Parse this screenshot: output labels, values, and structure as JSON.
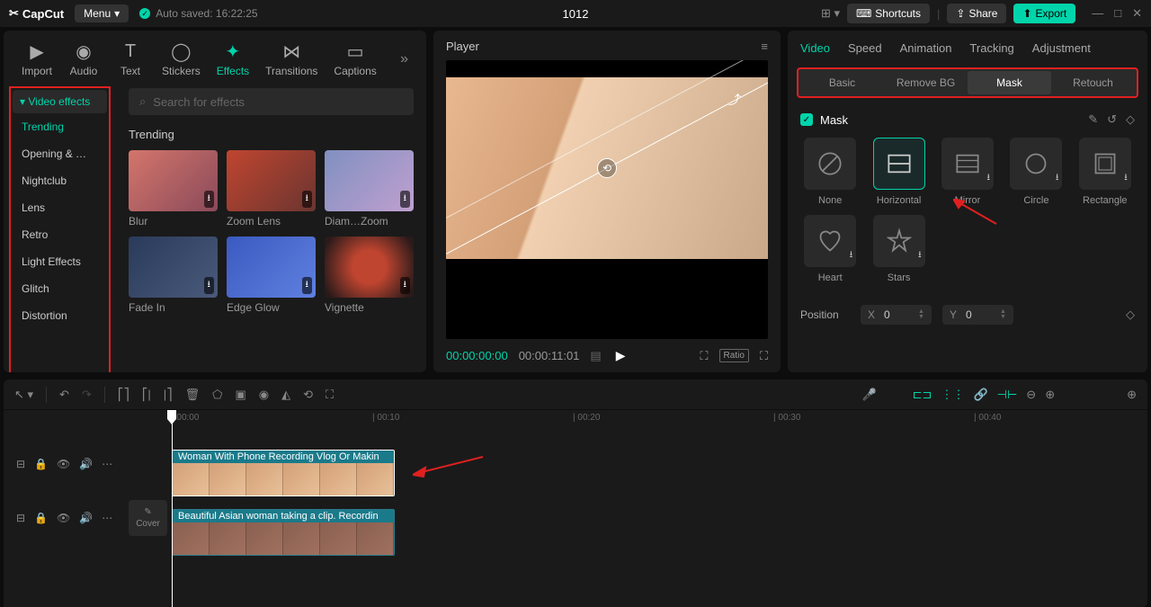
{
  "topbar": {
    "logo": "CapCut",
    "menu": "Menu",
    "autosave": "Auto saved: 16:22:25",
    "project": "1012",
    "shortcuts": "Shortcuts",
    "share": "Share",
    "export": "Export"
  },
  "tabs": {
    "items": [
      "Import",
      "Audio",
      "Text",
      "Stickers",
      "Effects",
      "Transitions",
      "Captions"
    ],
    "active": "Effects"
  },
  "sidebar": {
    "title": "Video effects",
    "items": [
      "Trending",
      "Opening & …",
      "Nightclub",
      "Lens",
      "Retro",
      "Light Effects",
      "Glitch",
      "Distortion"
    ],
    "active": "Trending"
  },
  "search": {
    "placeholder": "Search for effects"
  },
  "effects": {
    "section": "Trending",
    "items": [
      {
        "label": "Blur",
        "cls": "blur"
      },
      {
        "label": "Zoom Lens",
        "cls": "zoom"
      },
      {
        "label": "Diam…Zoom",
        "cls": "diam"
      },
      {
        "label": "Fade In",
        "cls": "fade"
      },
      {
        "label": "Edge Glow",
        "cls": "edge"
      },
      {
        "label": "Vignette",
        "cls": "vign"
      }
    ]
  },
  "player": {
    "title": "Player",
    "current": "00:00:00:00",
    "total": "00:00:11:01",
    "ratio": "Ratio"
  },
  "right": {
    "tabs": [
      "Video",
      "Speed",
      "Animation",
      "Tracking",
      "Adjustment"
    ],
    "active": "Video",
    "subtabs": [
      "Basic",
      "Remove BG",
      "Mask",
      "Retouch"
    ],
    "subactive": "Mask",
    "mask_title": "Mask",
    "masks": [
      "None",
      "Horizontal",
      "Mirror",
      "Circle",
      "Rectangle",
      "Heart",
      "Stars"
    ],
    "mask_selected": "Horizontal",
    "position_label": "Position",
    "x_label": "X",
    "x_val": "0",
    "y_label": "Y",
    "y_val": "0"
  },
  "timeline": {
    "marks": [
      "00:00",
      "00:10",
      "00:20",
      "00:30",
      "00:40"
    ],
    "clip1": "Woman With Phone Recording Vlog Or Makin",
    "clip2": "Beautiful Asian woman taking a clip. Recordin",
    "cover": "Cover"
  }
}
